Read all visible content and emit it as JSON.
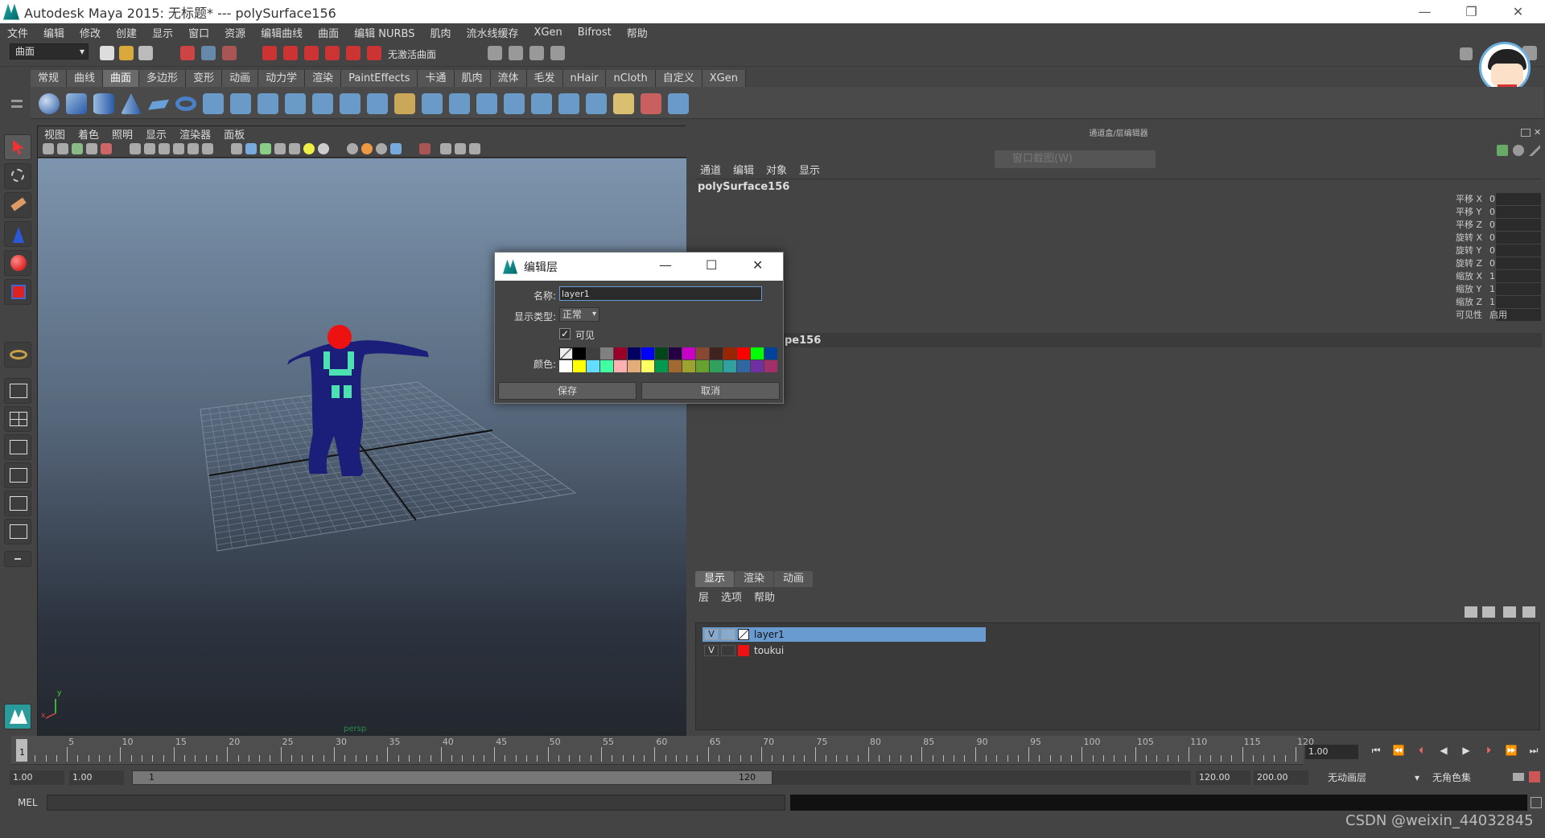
{
  "window": {
    "title": "Autodesk Maya 2015: 无标题*   ---   polySurface156",
    "minimize": "—",
    "maximize": "❐",
    "close": "✕"
  },
  "menu": [
    "文件",
    "编辑",
    "修改",
    "创建",
    "显示",
    "窗口",
    "资源",
    "编辑曲线",
    "曲面",
    "编辑 NURBS",
    "肌肉",
    "流水线缓存",
    "XGen",
    "Bifrost",
    "帮助"
  ],
  "toolbar": {
    "mode_select": "曲面",
    "no_live_surface": "无激活曲面"
  },
  "shelf_tabs": [
    "常规",
    "曲线",
    "曲面",
    "多边形",
    "变形",
    "动画",
    "动力学",
    "渲染",
    "PaintEffects",
    "卡通",
    "肌肉",
    "流体",
    "毛发",
    "nHair",
    "nCloth",
    "自定义",
    "XGen"
  ],
  "shelf_active": "曲面",
  "viewport": {
    "menu": [
      "视图",
      "着色",
      "照明",
      "显示",
      "渲染器",
      "面板"
    ],
    "camera_label": "persp",
    "axis_y": "y",
    "axis_x": "x"
  },
  "channel_box": {
    "header": "通道盒/层编辑器",
    "faded_hint": "窗口截图(W)",
    "menu": [
      "通道",
      "编辑",
      "对象",
      "显示"
    ],
    "object_name": "polySurface156",
    "attributes": [
      {
        "label": "平移 X",
        "value": "0"
      },
      {
        "label": "平移 Y",
        "value": "0"
      },
      {
        "label": "平移 Z",
        "value": "0"
      },
      {
        "label": "旋转 X",
        "value": "0"
      },
      {
        "label": "旋转 Y",
        "value": "0"
      },
      {
        "label": "旋转 Z",
        "value": "0"
      },
      {
        "label": "缩放 X",
        "value": "1"
      },
      {
        "label": "缩放 Y",
        "value": "1"
      },
      {
        "label": "缩放 Z",
        "value": "1"
      },
      {
        "label": "可见性",
        "value": "启用"
      }
    ],
    "shape_name_partial": "pe156"
  },
  "layer_editor": {
    "tabs": [
      "显示",
      "渲染",
      "动画"
    ],
    "active_tab": "显示",
    "menu": [
      "层",
      "选项",
      "帮助"
    ],
    "layers": [
      {
        "visible": "V",
        "name": "layer1",
        "color": "#6a9bd0",
        "selected": true
      },
      {
        "visible": "V",
        "name": "toukui",
        "color": "#ee1111",
        "selected": false
      }
    ]
  },
  "timeline": {
    "ticks": [
      "5",
      "10",
      "15",
      "20",
      "25",
      "30",
      "35",
      "40",
      "45",
      "50",
      "55",
      "60",
      "65",
      "70",
      "75",
      "80",
      "85",
      "90",
      "95",
      "100",
      "105",
      "110",
      "115",
      "120"
    ],
    "current_frame": "1",
    "current_time_field": "1.00"
  },
  "range": {
    "start_time": "1.00",
    "playback_start": "1.00",
    "range_start_label": "1",
    "range_end_label": "120",
    "playback_end": "120.00",
    "end_time": "200.00",
    "anim_layer": "无动画层",
    "character_set": "无角色集"
  },
  "command_line": {
    "label": "MEL"
  },
  "dialog": {
    "title": "编辑层",
    "name_label": "名称:",
    "name_value": "layer1",
    "display_type_label": "显示类型:",
    "display_type_value": "正常",
    "visible_label": "可见",
    "visible_checked": true,
    "color_label": "颜色:",
    "save_button": "保存",
    "cancel_button": "取消",
    "palette_row1": [
      "#000000",
      "#3f3f3f",
      "#808080",
      "#9b0028",
      "#000060",
      "#0000ff",
      "#004619",
      "#250043",
      "#c800c8",
      "#8a4833",
      "#3f231f",
      "#992600",
      "#ff0000",
      "#00ff00",
      "#004199"
    ],
    "palette_row2": [
      "#ffffff",
      "#ffff00",
      "#64dcff",
      "#43ffa3",
      "#ffb0b0",
      "#e4ac79",
      "#ffff63",
      "#00994f",
      "#a16930",
      "#9fa130",
      "#68a130",
      "#30a15d",
      "#30a1a1",
      "#3067a1",
      "#6f30a1",
      "#a1306a"
    ]
  },
  "watermark": "CSDN @weixin_44032845"
}
